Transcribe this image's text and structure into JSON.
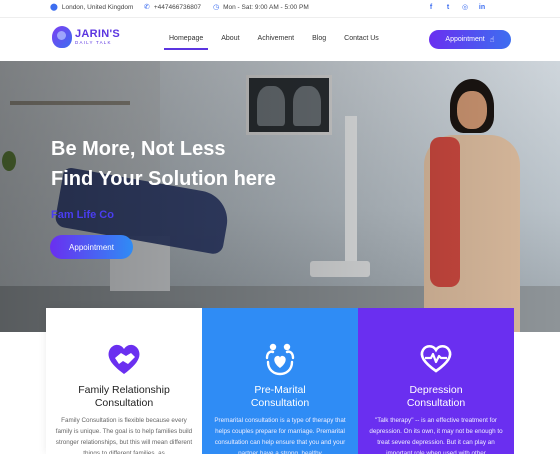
{
  "topbar": {
    "location": "London, United Kingdom",
    "phone": "+447466736807",
    "hours": "Mon - Sat: 9:00 AM - 5:00 PM",
    "socials": [
      {
        "icon": "facebook-icon",
        "glyph": "f"
      },
      {
        "icon": "twitter-icon",
        "glyph": "t"
      },
      {
        "icon": "instagram-icon",
        "glyph": "◎"
      },
      {
        "icon": "linkedin-icon",
        "glyph": "in"
      }
    ]
  },
  "header": {
    "logo_name": "JARIN'S",
    "logo_sub": "DAILY TALK",
    "nav": [
      "Homepage",
      "About",
      "Achivement",
      "Blog",
      "Contact Us"
    ],
    "active_nav": "Homepage",
    "cta": "Appointment"
  },
  "hero": {
    "line1": "Be More, Not Less",
    "line2": "Find Your Solution here",
    "brand": "Fam Life Co",
    "button": "Appointment"
  },
  "cards": [
    {
      "title_line1": "Family Relationship",
      "title_line2": "Consultation",
      "text": "Family Consultation is flexible because every family is unique. The goal is to help families build stronger relationships, but this will mean different things to different families, as",
      "icon": "handshake-heart-icon"
    },
    {
      "title_line1": "Pre-Marital",
      "title_line2": "Consultation",
      "text": "Premarital consultation is a type of therapy that helps couples prepare for marriage. Premarital consultation can help ensure that you and your partner have a strong, healthy",
      "icon": "couple-heart-icon"
    },
    {
      "title_line1": "Depression",
      "title_line2": "Consultation",
      "text": "\"Talk therapy\" -- is an effective treatment for depression. On its own, it may not be enough to treat severe depression. But it can play an important role when used with other",
      "icon": "heartbeat-icon"
    }
  ],
  "colors": {
    "primary_purple": "#6a2ff0",
    "primary_blue": "#2f8cf5",
    "accent_blue": "#3d6ef0"
  }
}
